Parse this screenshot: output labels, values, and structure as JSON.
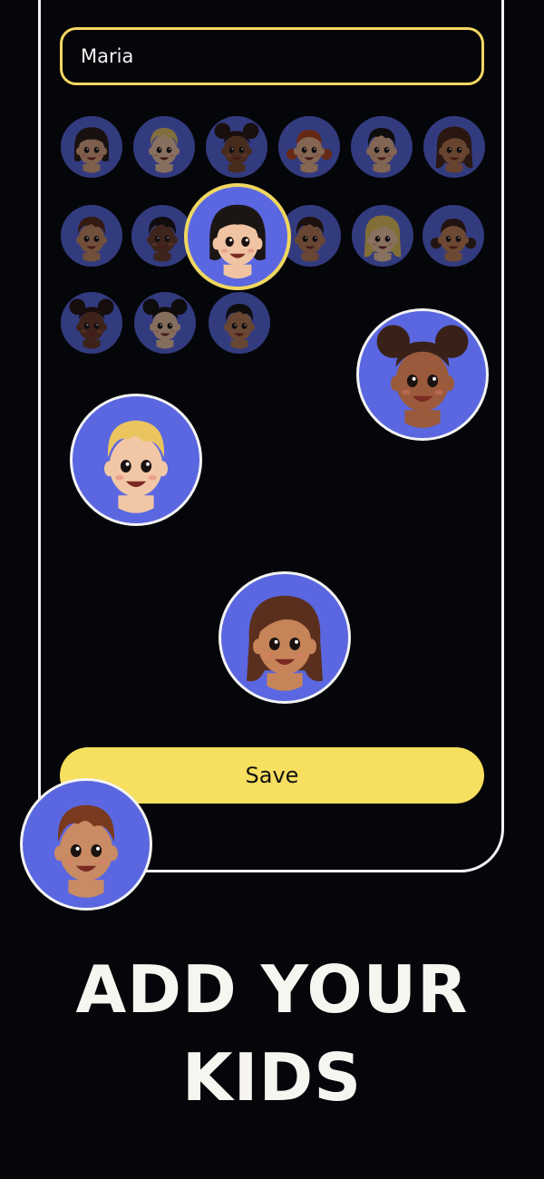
{
  "form": {
    "name_value": "Maria",
    "save_label": "Save"
  },
  "headline": {
    "line1": "ADD YOUR",
    "line2": "KIDS"
  },
  "colors": {
    "accent": "#f7df5f",
    "avatar_bg": "#5a67e0",
    "background": "#05060a"
  },
  "avatars": [
    {
      "name": "avatar-girl-black-hair",
      "skin": "#e2a784",
      "hair": "#2b1b16",
      "style": "bob"
    },
    {
      "name": "avatar-boy-blond",
      "skin": "#f2c7a6",
      "hair": "#e5c46a",
      "style": "short"
    },
    {
      "name": "avatar-girl-puffs",
      "skin": "#7d4b30",
      "hair": "#2a1710",
      "style": "puffs"
    },
    {
      "name": "avatar-girl-red-pigtails",
      "skin": "#efb58d",
      "hair": "#b4471f",
      "style": "pigtails"
    },
    {
      "name": "avatar-boy-dark-hair",
      "skin": "#e8b48f",
      "hair": "#17110f",
      "style": "short"
    },
    {
      "name": "avatar-girl-brown-flower",
      "skin": "#b8774f",
      "hair": "#4b2617",
      "style": "long"
    },
    {
      "name": "avatar-boy-brown-hair",
      "skin": "#c98b64",
      "hair": "#5b2c1c",
      "style": "short"
    },
    {
      "name": "avatar-boy-dark-skin",
      "skin": "#6c3f29",
      "hair": "#1c1210",
      "style": "short"
    },
    {
      "name": "avatar-girl-selected",
      "skin": "#f0c4a3",
      "hair": "#1b1514",
      "style": "bob"
    },
    {
      "name": "avatar-boy-medium-skin",
      "skin": "#b97c55",
      "hair": "#2e1a12",
      "style": "short"
    },
    {
      "name": "avatar-girl-blonde",
      "skin": "#f3c9a5",
      "hair": "#e9c35d",
      "style": "long"
    },
    {
      "name": "avatar-girl-braids",
      "skin": "#c38155",
      "hair": "#3b2117",
      "style": "pigtails"
    },
    {
      "name": "avatar-girl-curly-dark",
      "skin": "#6b3a27",
      "hair": "#24140f",
      "style": "puffs"
    },
    {
      "name": "avatar-girl-black-buns",
      "skin": "#f0c4a3",
      "hair": "#17110f",
      "style": "puffs"
    },
    {
      "name": "avatar-boy-black-hair",
      "skin": "#b77d56",
      "hair": "#17110f",
      "style": "short"
    },
    {
      "name": "avatar-girl-afro-puffs",
      "skin": "#9a5a3b",
      "hair": "#3a2118",
      "style": "puffs"
    },
    {
      "name": "avatar-boy-blond-curly",
      "skin": "#f2c7a6",
      "hair": "#eac45f",
      "style": "short"
    },
    {
      "name": "avatar-girl-flower",
      "skin": "#c78459",
      "hair": "#5b2f1e",
      "style": "long"
    },
    {
      "name": "avatar-boy-auburn",
      "skin": "#c98b64",
      "hair": "#7a3a1f",
      "style": "short"
    }
  ]
}
